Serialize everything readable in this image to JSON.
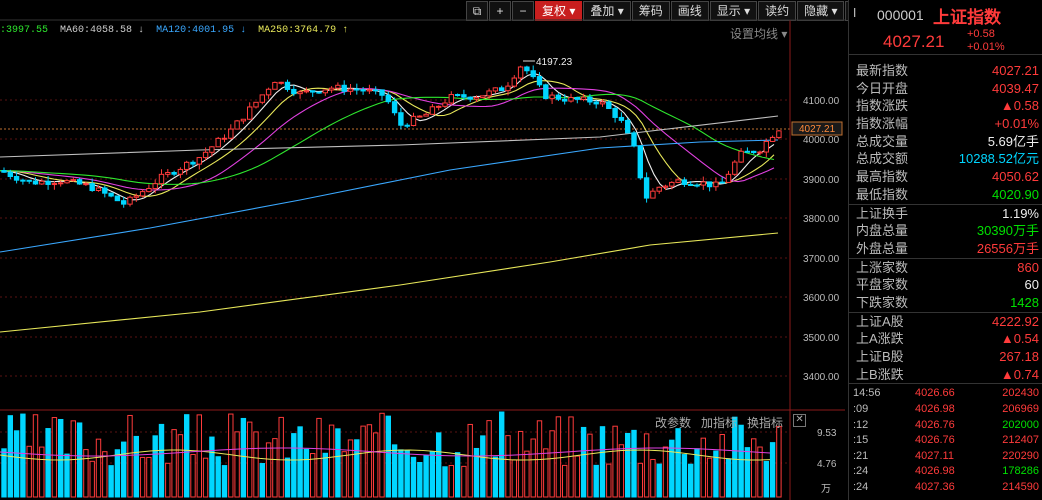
{
  "toolbar": {
    "buttons": [
      "复权 ▾",
      "叠加 ▾",
      "筹码",
      "画线",
      "显示 ▾",
      "读约",
      "隐藏 ▾"
    ]
  },
  "ma_legend": [
    {
      "text": ":3997.55",
      "color": "#2ee62e"
    },
    {
      "text": "MA60:4058.58 ↓",
      "color": "#cccccc"
    },
    {
      "text": "MA120:4001.95 ↓",
      "color": "#3aa8ff"
    },
    {
      "text": "MA250:3764.79 ↑",
      "color": "#e8e85a"
    }
  ],
  "settings_label": "设置均线 ▾",
  "price_axis": [
    "4100.00",
    "4000.00",
    "3900.00",
    "3800.00",
    "3700.00",
    "3600.00",
    "3500.00",
    "3400.00"
  ],
  "current_price_tag": "4027.21",
  "high_annotation": "4197.23",
  "volume_tools": [
    "改参数",
    "加指标",
    "换指标"
  ],
  "volume_axis": [
    "9.53",
    "4.76",
    "万"
  ],
  "colors": {
    "up": "#ff3b3b",
    "down": "#00d6ff",
    "flat": "#eeeeee"
  },
  "panel": {
    "code": "000001",
    "name": "上证指数",
    "price": "4027.21",
    "change": "+0.58",
    "change_pct": "+0.01%",
    "stats": [
      {
        "label": "最新指数",
        "value": "4027.21",
        "cls": "red"
      },
      {
        "label": "今日开盘",
        "value": "4039.47",
        "cls": "red"
      },
      {
        "label": "指数涨跌",
        "value": "▲0.58",
        "cls": "red"
      },
      {
        "label": "指数涨幅",
        "value": "+0.01%",
        "cls": "red"
      },
      {
        "label": "总成交量",
        "value": "5.69亿手",
        "cls": "white"
      },
      {
        "label": "总成交额",
        "value": "10288.52亿元",
        "cls": "cyan"
      },
      {
        "label": "最高指数",
        "value": "4050.62",
        "cls": "red"
      },
      {
        "label": "最低指数",
        "value": "4020.90",
        "cls": "green"
      }
    ],
    "stats2": [
      {
        "label": "上证换手",
        "value": "1.19%",
        "cls": "white"
      },
      {
        "label": "内盘总量",
        "value": "30390万手",
        "cls": "green"
      },
      {
        "label": "外盘总量",
        "value": "26556万手",
        "cls": "red"
      }
    ],
    "stats3": [
      {
        "label": "上涨家数",
        "value": "860",
        "cls": "red"
      },
      {
        "label": "平盘家数",
        "value": "60",
        "cls": "white"
      },
      {
        "label": "下跌家数",
        "value": "1428",
        "cls": "green"
      }
    ],
    "stats4": [
      {
        "label": "上证A股",
        "value": "4222.92",
        "cls": "red"
      },
      {
        "label": "上A涨跌",
        "value": "▲0.54",
        "cls": "red"
      },
      {
        "label": "上证B股",
        "value": "267.18",
        "cls": "red"
      },
      {
        "label": "上B涨跌",
        "value": "▲0.74",
        "cls": "red"
      }
    ],
    "ticks": [
      {
        "time": "14:56",
        "price": "4026.66",
        "vol": "202430",
        "cls": "red"
      },
      {
        "time": ":09",
        "price": "4026.98",
        "vol": "206969",
        "cls": "red"
      },
      {
        "time": ":12",
        "price": "4026.76",
        "vol": "202000",
        "cls": "green"
      },
      {
        "time": ":15",
        "price": "4026.76",
        "vol": "212407",
        "cls": "red"
      },
      {
        "time": ":21",
        "price": "4027.11",
        "vol": "220290",
        "cls": "red"
      },
      {
        "time": ":24",
        "price": "4026.98",
        "vol": "178286",
        "cls": "green"
      },
      {
        "time": ":24",
        "price": "4027.36",
        "vol": "214590",
        "cls": "red"
      }
    ]
  }
}
